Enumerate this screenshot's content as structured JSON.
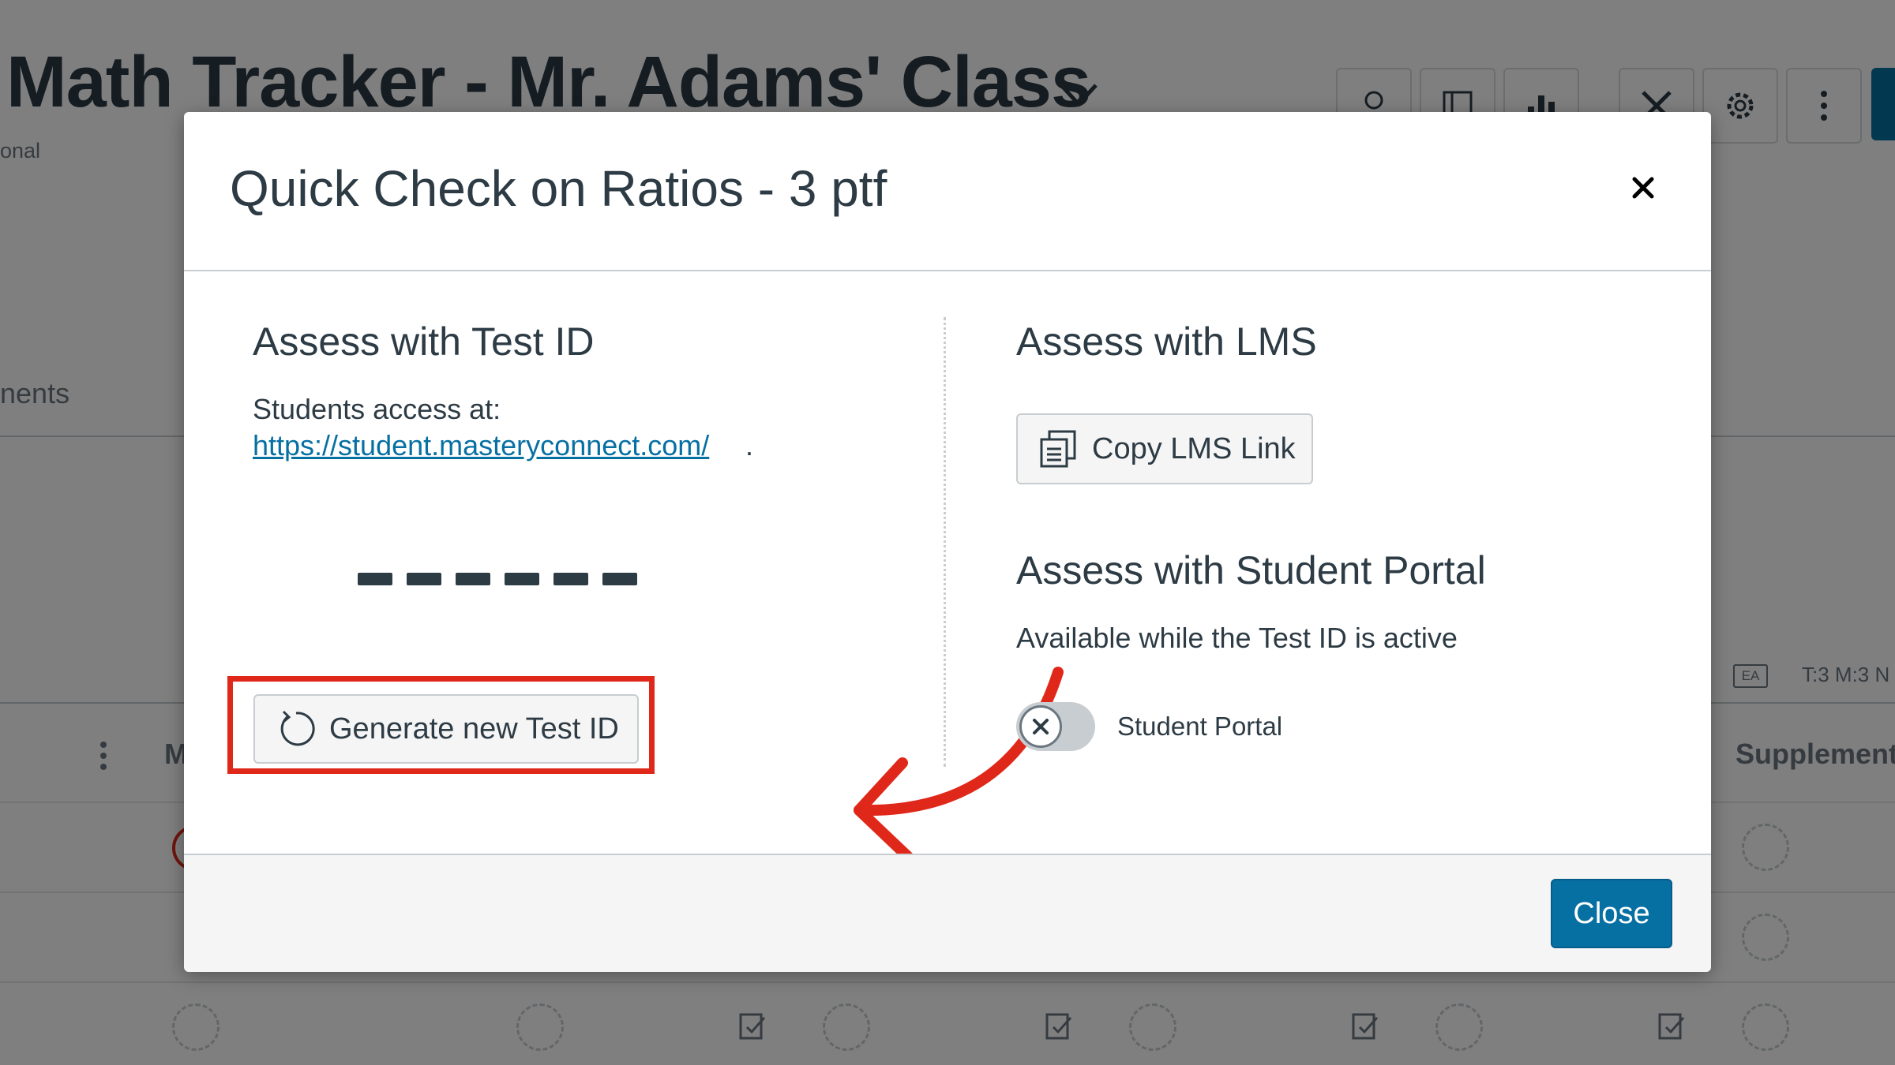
{
  "background": {
    "page_title": "Math Tracker - Mr. Adams' Class",
    "subtitle_fragment": "onal",
    "tab_fragment": "nents",
    "ea_badge": "EA",
    "tm_text": "T:3 M:3 N",
    "column_header_fragment": "M",
    "column_header_right": "Supplement"
  },
  "modal": {
    "title": "Quick Check on Ratios - 3 ptf",
    "left": {
      "heading": "Assess with Test ID",
      "access_label": "Students access at:",
      "access_link": "https://student.masteryconnect.com/",
      "access_link_suffix": ".",
      "generate_button": "Generate new Test ID"
    },
    "right": {
      "lms_heading": "Assess with LMS",
      "copy_button": "Copy LMS Link",
      "portal_heading": "Assess with Student Portal",
      "portal_description": "Available while the Test ID is active",
      "toggle_label": "Student Portal",
      "toggle_on": false
    },
    "footer": {
      "close_button": "Close"
    }
  },
  "colors": {
    "primary": "#0770a3",
    "annotation_red": "#e0281a",
    "text": "#2d3b45"
  }
}
